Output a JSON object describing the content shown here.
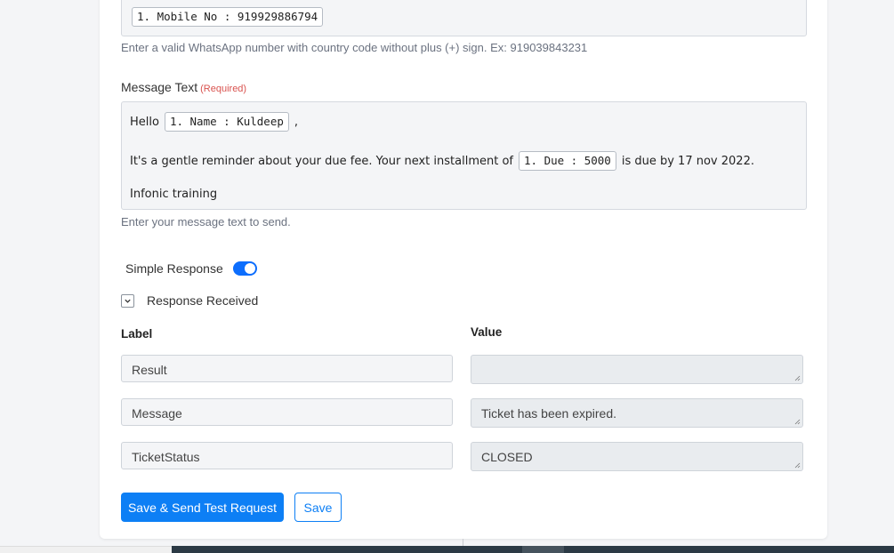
{
  "mobile": {
    "token": "1. Mobile No : 919929886794",
    "help": "Enter a valid WhatsApp number with country code without plus (+) sign. Ex: 919039843231"
  },
  "message": {
    "label": "Message Text",
    "required": "(Required)",
    "line1_prefix": "Hello",
    "line1_token": "1. Name : Kuldeep",
    "line1_suffix": ",",
    "line2_prefix": "It's a gentle reminder about your due fee. Your next installment of",
    "line2_token": "1. Due : 5000",
    "line2_suffix": "is due by 17 nov 2022.",
    "line3": "Infonic training",
    "help": "Enter your message text to send."
  },
  "simple_response": {
    "label": "Simple Response",
    "enabled": true
  },
  "response_received": {
    "label": "Response Received"
  },
  "table": {
    "label_header": "Label",
    "value_header": "Value",
    "rows": [
      {
        "label": "Result",
        "value": ""
      },
      {
        "label": "Message",
        "value": "Ticket has been expired."
      },
      {
        "label": "TicketStatus",
        "value": "CLOSED"
      }
    ]
  },
  "buttons": {
    "save_send": "Save & Send Test Request",
    "save": "Save"
  },
  "colors": {
    "accent": "#0d7ff5",
    "required": "#d9534f"
  }
}
